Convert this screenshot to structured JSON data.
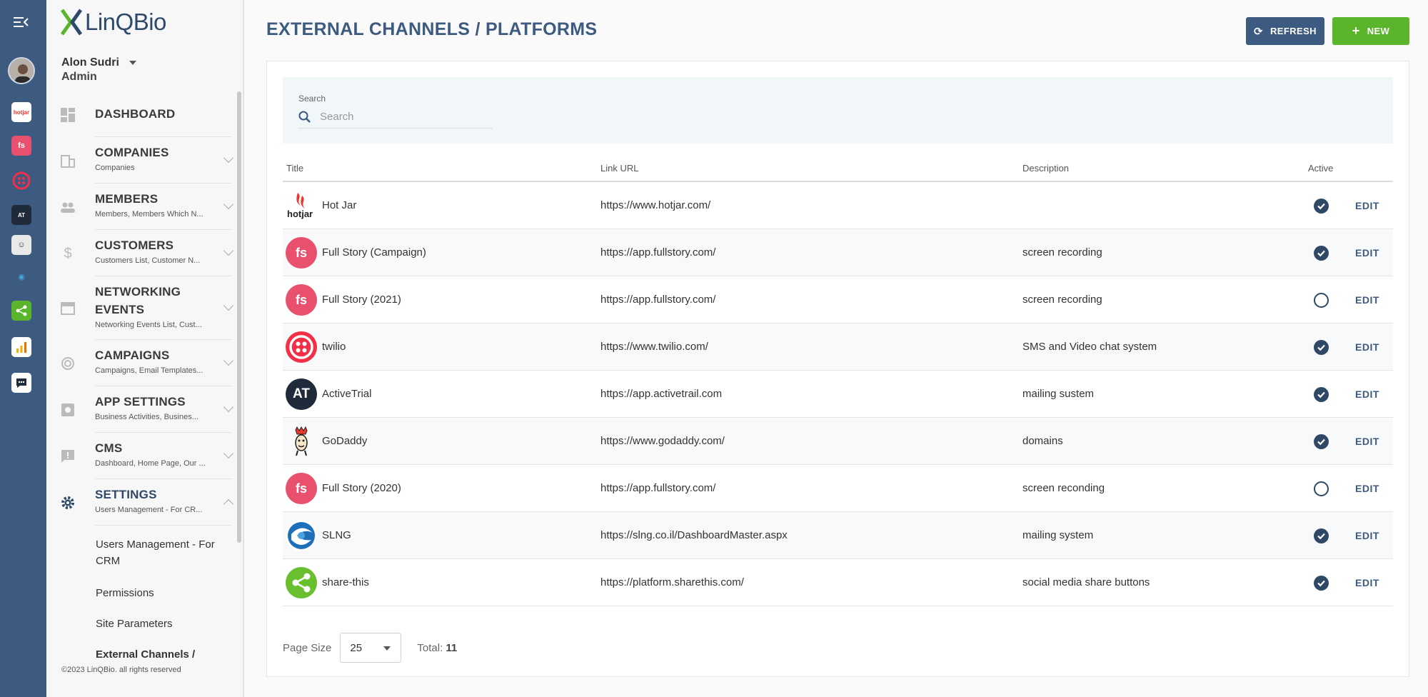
{
  "brand": {
    "logo_text_1": "LinQ",
    "logo_text_2": "Bio",
    "accent": "#5ab52b",
    "primary": "#3d5a80"
  },
  "user": {
    "name": "Alon Sudri",
    "role": "Admin"
  },
  "nav": [
    {
      "title": "DASHBOARD",
      "sub": ""
    },
    {
      "title": "COMPANIES",
      "sub": "Companies"
    },
    {
      "title": "MEMBERS",
      "sub": "Members, Members Which N..."
    },
    {
      "title": "CUSTOMERS",
      "sub": "Customers List, Customer N..."
    },
    {
      "title": "NETWORKING EVENTS",
      "sub": "Networking Events List, Cust..."
    },
    {
      "title": "CAMPAIGNS",
      "sub": "Campaigns, Email Templates..."
    },
    {
      "title": "APP SETTINGS",
      "sub": "Business Activities, Busines..."
    },
    {
      "title": "CMS",
      "sub": "Dashboard, Home Page, Our ..."
    },
    {
      "title": "SETTINGS",
      "sub": "Users Management - For CR..."
    }
  ],
  "settings_sub": [
    "Users Management - For CRM",
    "Permissions",
    "Site Parameters",
    "External Channels /"
  ],
  "footer": "©2023 LinQBio. all rights reserved",
  "page": {
    "title": "EXTERNAL CHANNELS / PLATFORMS",
    "refresh_label": "REFRESH",
    "new_label": "NEW"
  },
  "search": {
    "label": "Search",
    "placeholder": "Search"
  },
  "table": {
    "headers": [
      "Title",
      "Link URL",
      "Description",
      "Active"
    ],
    "edit_label": "EDIT",
    "rows": [
      {
        "title": "Hot Jar",
        "url": "https://www.hotjar.com/",
        "description": "",
        "active": true,
        "icon": "hotjar"
      },
      {
        "title": "Full Story (Campaign)",
        "url": "https://app.fullstory.com/",
        "description": "screen recording",
        "active": true,
        "icon": "fullstory"
      },
      {
        "title": "Full Story (2021)",
        "url": "https://app.fullstory.com/",
        "description": "screen recording",
        "active": false,
        "icon": "fullstory"
      },
      {
        "title": "twilio",
        "url": "https://www.twilio.com/",
        "description": "SMS and Video chat system",
        "active": true,
        "icon": "twilio"
      },
      {
        "title": "ActiveTrial",
        "url": "https://app.activetrail.com",
        "description": "mailing sustem",
        "active": true,
        "icon": "activetrail"
      },
      {
        "title": "GoDaddy",
        "url": "https://www.godaddy.com/",
        "description": "domains",
        "active": true,
        "icon": "godaddy"
      },
      {
        "title": "Full Story (2020)",
        "url": "https://app.fullstory.com/",
        "description": "screen reconding",
        "active": false,
        "icon": "fullstory"
      },
      {
        "title": "SLNG",
        "url": "https://slng.co.il/DashboardMaster.aspx",
        "description": "mailing system",
        "active": true,
        "icon": "slng"
      },
      {
        "title": "share-this",
        "url": "https://platform.sharethis.com/",
        "description": "social media share buttons",
        "active": true,
        "icon": "sharethis"
      }
    ]
  },
  "pager": {
    "label": "Page Size",
    "size": "25",
    "total_label": "Total:",
    "total": "11"
  }
}
